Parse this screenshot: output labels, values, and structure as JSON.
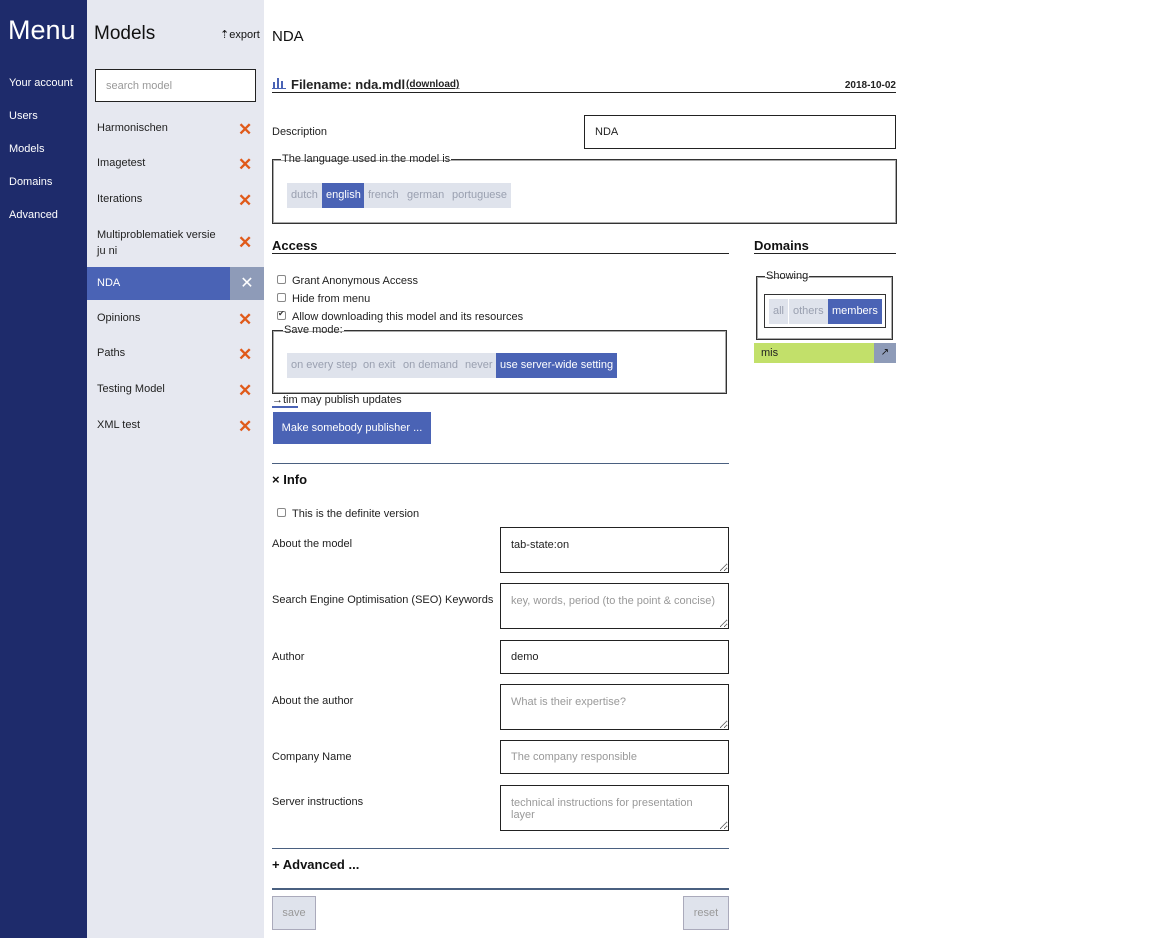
{
  "menu": {
    "title": "Menu",
    "items": [
      "Your account",
      "Users",
      "Models",
      "Domains",
      "Advanced"
    ]
  },
  "models_panel": {
    "title": "Models",
    "export_label": "export",
    "search_placeholder": "search model",
    "items": [
      {
        "label": "Harmonischen"
      },
      {
        "label": "Imagetest"
      },
      {
        "label": "Iterations"
      },
      {
        "label": "Multiproblematiek versie ju ni"
      },
      {
        "label": "NDA",
        "active": true
      },
      {
        "label": "Opinions"
      },
      {
        "label": "Paths"
      },
      {
        "label": "Testing Model"
      },
      {
        "label": "XML test"
      }
    ],
    "delete_glyph": "✕"
  },
  "model": {
    "title": "NDA",
    "filename_label": "Filename: nda.mdl",
    "download_label": "(download)",
    "date": "2018-10-02",
    "description_label": "Description",
    "description_value": "NDA",
    "language_legend": "The language used in the model is",
    "languages": [
      "dutch",
      "english",
      "french",
      "german",
      "portuguese"
    ],
    "language_selected": "english"
  },
  "access": {
    "heading": "Access",
    "options": [
      {
        "label": "Grant Anonymous Access",
        "checked": false
      },
      {
        "label": "Hide from menu",
        "checked": false
      },
      {
        "label": "Allow downloading this model and its resources",
        "checked": true
      }
    ],
    "save_mode_legend": "Save mode:",
    "save_modes": [
      "on every step",
      "on exit",
      "on demand",
      "never",
      "use server-wide setting"
    ],
    "save_mode_selected": "use server-wide setting",
    "publisher_link": "→tim",
    "publisher_text": "may publish updates",
    "make_publisher_button": "Make somebody publisher ..."
  },
  "domains": {
    "heading": "Domains",
    "showing_legend": "Showing",
    "filters": [
      "all",
      "others",
      "members"
    ],
    "filter_selected": "members",
    "entries": [
      {
        "name": "mis",
        "action": "↗"
      }
    ]
  },
  "info": {
    "toggle": "×",
    "heading": "Info",
    "definite_label": "This is the definite version",
    "fields": {
      "about_model": {
        "label": "About the model",
        "value": "tab-state:on",
        "placeholder": ""
      },
      "seo": {
        "label": "Search Engine Optimisation (SEO) Keywords",
        "value": "",
        "placeholder": "key, words, period (to the point & concise)"
      },
      "author": {
        "label": "Author",
        "value": "demo",
        "placeholder": ""
      },
      "about_author": {
        "label": "About the author",
        "value": "",
        "placeholder": "What is their expertise?"
      },
      "company": {
        "label": "Company Name",
        "value": "",
        "placeholder": "The company responsible"
      },
      "server": {
        "label": "Server instructions",
        "value": "",
        "placeholder": "technical instructions for presentation layer"
      }
    }
  },
  "advanced": {
    "toggle": "+",
    "heading": "Advanced ..."
  },
  "footer": {
    "save_label": "save",
    "reset_label": "reset"
  },
  "colors": {
    "menu_bg": "#1e2b6b",
    "panel_bg": "#e6e8f0",
    "accent": "#4a63b5",
    "delete": "#e05a1a",
    "domain_entry": "#c2e06a"
  }
}
